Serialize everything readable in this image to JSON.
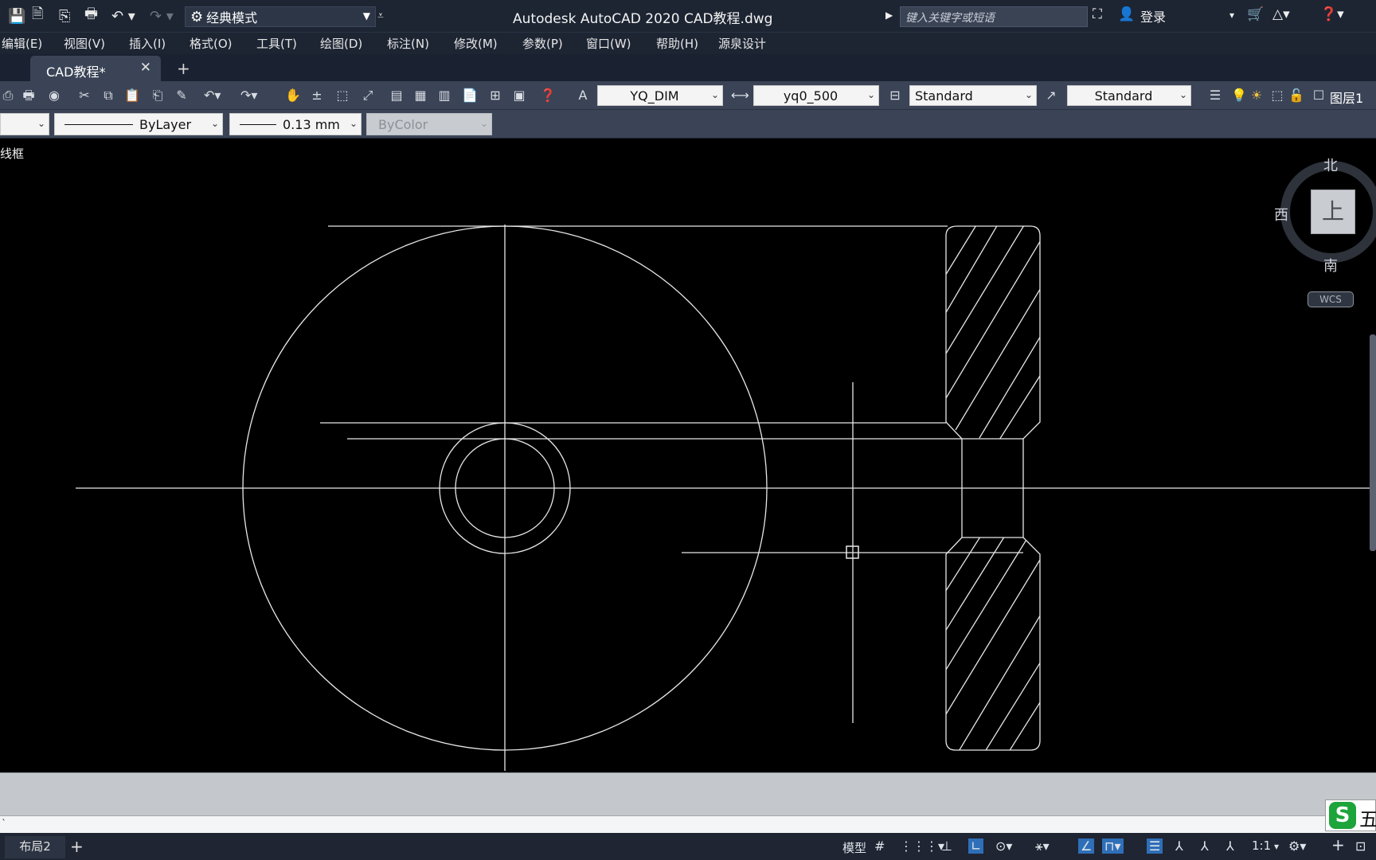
{
  "title_bar": {
    "workspace": "经典模式",
    "app_title": "Autodesk AutoCAD 2020    CAD教程.dwg",
    "search_placeholder": "键入关键字或短语",
    "login": "登录"
  },
  "menu": [
    "编辑(E)",
    "视图(V)",
    "插入(I)",
    "格式(O)",
    "工具(T)",
    "绘图(D)",
    "标注(N)",
    "修改(M)",
    "参数(P)",
    "窗口(W)",
    "帮助(H)",
    "源泉设计"
  ],
  "tabs": {
    "active": "CAD教程*",
    "add": "+"
  },
  "toolbar1": {
    "dim_style": "YQ_DIM",
    "text_style": "yq0_500",
    "table_style": "Standard",
    "multileader_style": "Standard",
    "layer": "图层1"
  },
  "toolbar2": {
    "linetype": "ByLayer",
    "lineweight": "0.13 mm",
    "plot_style": "ByColor"
  },
  "viewport": {
    "label": "线框"
  },
  "viewcube": {
    "north": "北",
    "south": "南",
    "west": "西",
    "face": "上",
    "wcs": "WCS"
  },
  "status_bar": {
    "layout_tab": "布局2",
    "model": "模型",
    "scale": "1:1"
  },
  "ime": {
    "logo": "S",
    "text": "五"
  },
  "colors": {
    "title_bg": "#1d2533",
    "toolbar_bg": "#3b4456",
    "canvas_bg": "#000000",
    "line": "#e8e8e8"
  }
}
